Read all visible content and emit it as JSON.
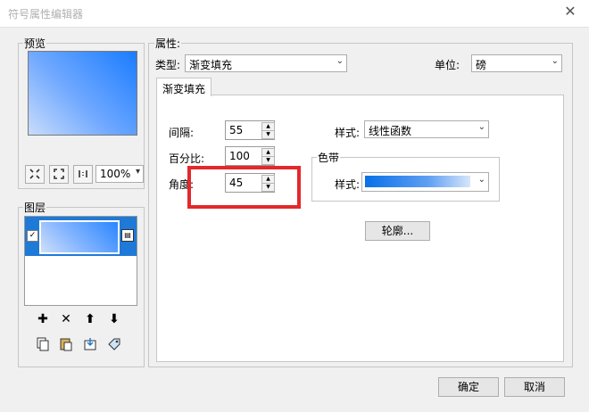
{
  "window": {
    "title": "符号属性编辑器",
    "close_glyph": "✕"
  },
  "preview": {
    "group_label": "预览",
    "zoom": "100%",
    "tool_icons": [
      "zoom-in",
      "zoom-out",
      "actual-size"
    ]
  },
  "layers": {
    "group_label": "图层",
    "checked": true,
    "layer_buttons": [
      "add-layer",
      "remove-layer",
      "move-up",
      "move-down"
    ],
    "edit_buttons": [
      "copy",
      "paste",
      "import",
      "tag"
    ]
  },
  "properties": {
    "group_label": "属性:",
    "type_label": "类型:",
    "type_value": "渐变填充",
    "unit_label": "单位:",
    "unit_value": "磅",
    "tab_label": "渐变填充",
    "interval_label": "间隔:",
    "interval_value": "55",
    "percent_label": "百分比:",
    "percent_value": "100",
    "angle_label": "角度:",
    "angle_value": "45",
    "style_label": "样式:",
    "style_value": "线性函数",
    "ramp_group_label": "色带",
    "ramp_style_label": "样式:",
    "outline_button": "轮廓..."
  },
  "footer": {
    "ok_label": "确定",
    "cancel_label": "取消"
  },
  "colors": {
    "highlight": "#e3282c",
    "ramp_start": "#0a6fe8",
    "ramp_end": "#d6e6fb",
    "selection": "#1e7ad6"
  }
}
